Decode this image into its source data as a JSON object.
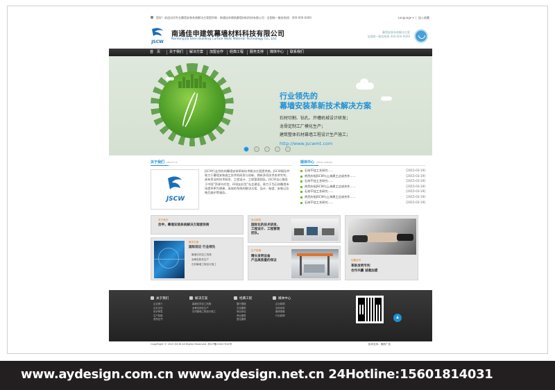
{
  "topbar": {
    "welcome": "您好！欢迎访问专业幕墙安装系统解决方案提供商 · 南通佳申建筑幕墙材料科技有限公司 · 全国统一服务热线：400-000-0000",
    "language": "Language ▾",
    "bookmark": "加入收藏"
  },
  "header": {
    "logo_text": "JSCW",
    "company_cn": "南通佳申建筑幕墙材料科技有限公司",
    "company_en": "Nantong Jia Shen Building Curtain Walls Material Technology Co., Ltd.",
    "slogan_right": "幕墙安装系统解决方案",
    "hotline_right": "全国统一服务热线 400-000-0000"
  },
  "nav": {
    "items": [
      "首　页",
      "关于我们",
      "解决方案",
      "加盟合作",
      "经典工程",
      "服务支持",
      "媒体中心",
      "联系我们"
    ]
  },
  "banner": {
    "headline1": "行业领先的",
    "headline2": "幕墙安装革新技术解决方案",
    "lines": [
      "石材切割、钻孔、开槽机械设计研发；",
      "龙骨定制工厂模化生产；",
      "建筑整体石材幕墙工程设计生产施工；"
    ],
    "url": "http://www.jscwmt.com"
  },
  "about": {
    "title": "关于我们",
    "title_en": "ABOUT US",
    "logo_text": "JSCW",
    "text": "JSCW行业领先的幕墙安装革新技术解决方案提供商。JSCW倡导并致力于幕墙安装施工技术的研发与创新，拥有多项技术发明专利，具有资深的技术研发、工程设计、工程管理团队。JSCW全心服务于中国“资源节约型、环境友好型”社会建设，致力于为石材幕墙市场提供更为便捷，高效的系统的解决方案、设计、制造、安装以及售后维护等服务。"
  },
  "media": {
    "title": "媒体中心",
    "title_en": "MEDIA CENTER",
    "items": [
      {
        "title": "石材干挂工艺研究......",
        "date": "[2015-03-19]"
      },
      {
        "title": "热烈庆祝JSCW与上海建工达成合作......",
        "date": "[2015-03-19]"
      },
      {
        "title": "石材干挂工艺研究......",
        "date": "[2015-03-19]"
      },
      {
        "title": "热烈庆祝JSCW与上海建工达成合作......",
        "date": "[2015-03-19]"
      },
      {
        "title": "石材干挂工艺研究......",
        "date": "[2015-03-19]"
      },
      {
        "title": "热烈庆祝JSCW与上海建工达成合作......",
        "date": "[2015-03-19]"
      },
      {
        "title": "石材干挂工艺研究......",
        "date": "[2015-03-19]"
      }
    ]
  },
  "boxes": {
    "about": {
      "tag": "关于我们",
      "title": "佳申，幕墙安装系统解决方案提供商"
    },
    "solution": {
      "tag": "解决方案",
      "title": "国际前沿 行业领先",
      "lines": [
        "幕墙石材加工机械",
        "龙骨定制化生产",
        "石材幕墙工程设计施工"
      ]
    },
    "design": {
      "tag": "设计研发",
      "title_lines": [
        "国际化的技术研发、",
        "工程设计、工程管理",
        "团队。"
      ]
    },
    "production": {
      "tag": "生产制造",
      "title_lines": [
        "精尖发明设备",
        "产品高质量的保证"
      ]
    },
    "join": {
      "tag": "加盟合作",
      "title_lines": [
        "革新发明专利",
        "合作共赢 诚邀加盟"
      ]
    }
  },
  "footer": {
    "cols": [
      {
        "head": "关于我们",
        "links": [
          "企业简介",
          "企业文化",
          "设计研发",
          "生产制造",
          "资质证书"
        ]
      },
      {
        "head": "解决方案",
        "links": [
          "幕墙石材加工机械",
          "龙骨定制化生产",
          "石材幕墙工程设计施工"
        ]
      },
      {
        "head": "经典工程",
        "links": [
          "展厅展馆",
          "文化建筑",
          "商业综合",
          "商业建筑",
          "居住建筑"
        ]
      },
      {
        "head": "媒体中心",
        "links": [
          "企业新闻",
          "活动动态",
          "媒体报道",
          "行业新闻"
        ]
      }
    ],
    "copyright": "CopyRight © 2015 JSCW All Rights Reserved. 苏ICP备15047032号",
    "tech": "技术支持：奥韵广告"
  },
  "watermark": {
    "text": "www.aydesign.com.cn www.aydesign.net.cn 24Hotline:15601814031"
  }
}
